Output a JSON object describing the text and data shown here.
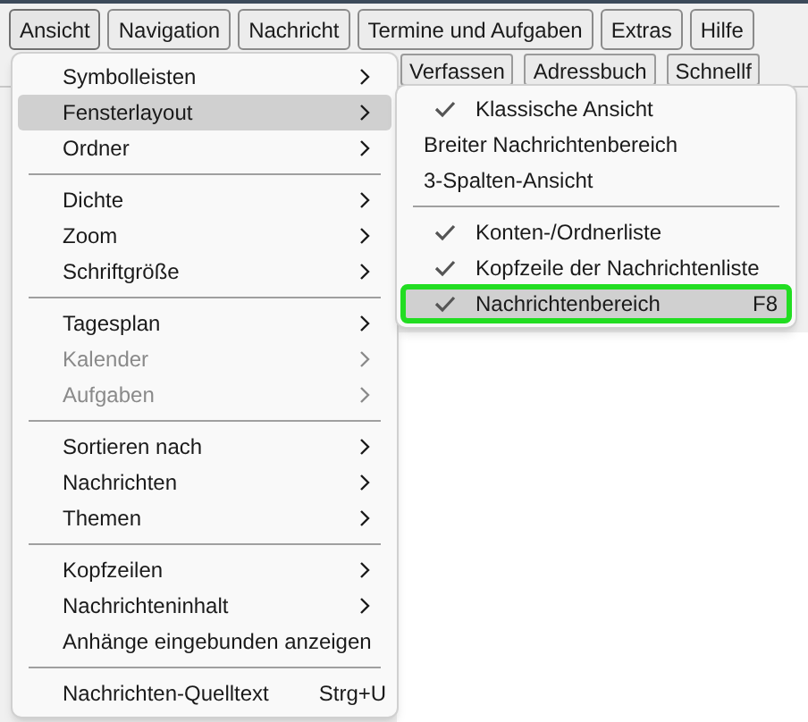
{
  "menubar": [
    {
      "label": "Ansicht",
      "selected": true
    },
    {
      "label": "Navigation",
      "selected": false
    },
    {
      "label": "Nachricht",
      "selected": false
    },
    {
      "label": "Termine und Aufgaben",
      "selected": false
    },
    {
      "label": "Extras",
      "selected": false
    },
    {
      "label": "Hilfe",
      "selected": false
    }
  ],
  "toolbar": {
    "buttons": [
      "Verfassen",
      "Adressbuch",
      "Schnellf"
    ]
  },
  "menu": {
    "items": [
      {
        "kind": "item",
        "label": "Symbolleisten",
        "submenu": true,
        "disabled": false,
        "selected": false
      },
      {
        "kind": "item",
        "label": "Fensterlayout",
        "submenu": true,
        "disabled": false,
        "selected": true
      },
      {
        "kind": "item",
        "label": "Ordner",
        "submenu": true,
        "disabled": false,
        "selected": false
      },
      {
        "kind": "separator"
      },
      {
        "kind": "item",
        "label": "Dichte",
        "submenu": true,
        "disabled": false,
        "selected": false
      },
      {
        "kind": "item",
        "label": "Zoom",
        "submenu": true,
        "disabled": false,
        "selected": false
      },
      {
        "kind": "item",
        "label": "Schriftgröße",
        "submenu": true,
        "disabled": false,
        "selected": false
      },
      {
        "kind": "separator"
      },
      {
        "kind": "item",
        "label": "Tagesplan",
        "submenu": true,
        "disabled": false,
        "selected": false
      },
      {
        "kind": "item",
        "label": "Kalender",
        "submenu": true,
        "disabled": true,
        "selected": false
      },
      {
        "kind": "item",
        "label": "Aufgaben",
        "submenu": true,
        "disabled": true,
        "selected": false
      },
      {
        "kind": "separator"
      },
      {
        "kind": "item",
        "label": "Sortieren nach",
        "submenu": true,
        "disabled": false,
        "selected": false
      },
      {
        "kind": "item",
        "label": "Nachrichten",
        "submenu": true,
        "disabled": false,
        "selected": false
      },
      {
        "kind": "item",
        "label": "Themen",
        "submenu": true,
        "disabled": false,
        "selected": false
      },
      {
        "kind": "separator"
      },
      {
        "kind": "item",
        "label": "Kopfzeilen",
        "submenu": true,
        "disabled": false,
        "selected": false
      },
      {
        "kind": "item",
        "label": "Nachrichteninhalt",
        "submenu": true,
        "disabled": false,
        "selected": false
      },
      {
        "kind": "item",
        "label": "Anhänge eingebunden anzeigen",
        "submenu": false,
        "disabled": false,
        "selected": false
      },
      {
        "kind": "separator"
      },
      {
        "kind": "item",
        "label": "Nachrichten-Quelltext",
        "shortcut": "Strg+U",
        "submenu": false,
        "disabled": false,
        "selected": false
      }
    ]
  },
  "submenu": {
    "items": [
      {
        "kind": "item",
        "label": "Klassische Ansicht",
        "checked": true,
        "selected": false,
        "outlined": false
      },
      {
        "kind": "item",
        "label": "Breiter Nachrichtenbereich",
        "checked": false,
        "selected": false,
        "outlined": false
      },
      {
        "kind": "item",
        "label": "3-Spalten-Ansicht",
        "checked": false,
        "selected": false,
        "outlined": false
      },
      {
        "kind": "separator"
      },
      {
        "kind": "item",
        "label": "Konten-/Ordnerliste",
        "checked": true,
        "selected": false,
        "outlined": false
      },
      {
        "kind": "item",
        "label": "Kopfzeile der Nachrichtenliste",
        "checked": true,
        "selected": false,
        "outlined": false
      },
      {
        "kind": "item",
        "label": "Nachrichtenbereich",
        "shortcut": "F8",
        "checked": true,
        "selected": true,
        "outlined": true
      }
    ]
  }
}
